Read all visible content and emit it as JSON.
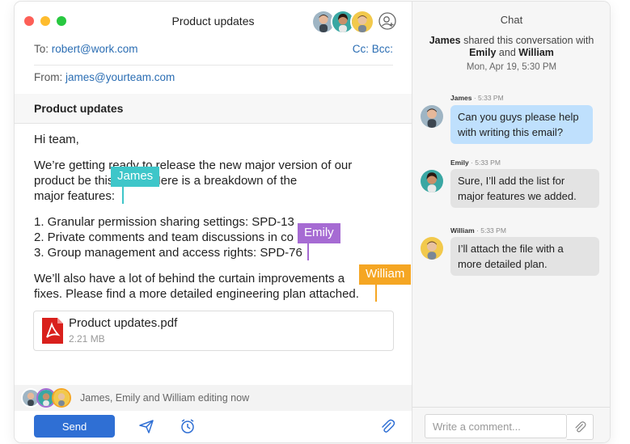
{
  "window": {
    "title": "Product updates"
  },
  "header": {
    "to_label": "To:",
    "to_value": "robert@work.com",
    "cc_bcc": "Cc: Bcc:",
    "from_label": "From:",
    "from_value": "james@yourteam.com",
    "subject": "Product updates"
  },
  "body": {
    "greeting": "Hi team,",
    "intro_lines": [
      "We’re getting ready to release the new major version of our",
      "product be this week. Here is a breakdown of the",
      "major features:"
    ],
    "features": [
      "1. Granular permission sharing settings: SPD-13",
      "2. Private comments and team discussions in co     PD-45",
      "3. Group management and access rights: SPD-76"
    ],
    "closing_lines": [
      "We’ll also have a lot of behind the curtain improvements a",
      "fixes. Please find a more detailed engineering plan attached."
    ]
  },
  "cursors": [
    {
      "name": "James",
      "color": "#3ec6c9"
    },
    {
      "name": "Emily",
      "color": "#a66bd3"
    },
    {
      "name": "William",
      "color": "#f5a623"
    }
  ],
  "attachment": {
    "name": "Product updates.pdf",
    "size": "2.21 MB"
  },
  "footer": {
    "editing_text": "James, Emily and William editing now",
    "send_label": "Send"
  },
  "chat": {
    "title": "Chat",
    "share_who": "James",
    "share_mid": " shared this conversation with",
    "share_names_a": "Emily",
    "share_and": " and ",
    "share_names_b": "William",
    "share_date": "Mon, Apr 19, 5:30 PM",
    "messages": [
      {
        "author": "James",
        "time": " · 5:33 PM",
        "text_lines": [
          "Can you guys please help",
          "with writing this email?"
        ]
      },
      {
        "author": "Emily",
        "time": " · 5:33 PM",
        "text_lines": [
          "Sure, I’ll add the list for",
          "major features we added."
        ]
      },
      {
        "author": "William",
        "time": " · 5:33 PM",
        "text_lines": [
          "I’ll attach the file with a",
          "more detailed plan."
        ]
      }
    ],
    "input_placeholder": "Write a comment..."
  },
  "colors": {
    "accent": "#2f6fd4",
    "link": "#2a6db3",
    "own_bubble": "#bfe0fd",
    "other_bubble": "#e3e3e3"
  }
}
